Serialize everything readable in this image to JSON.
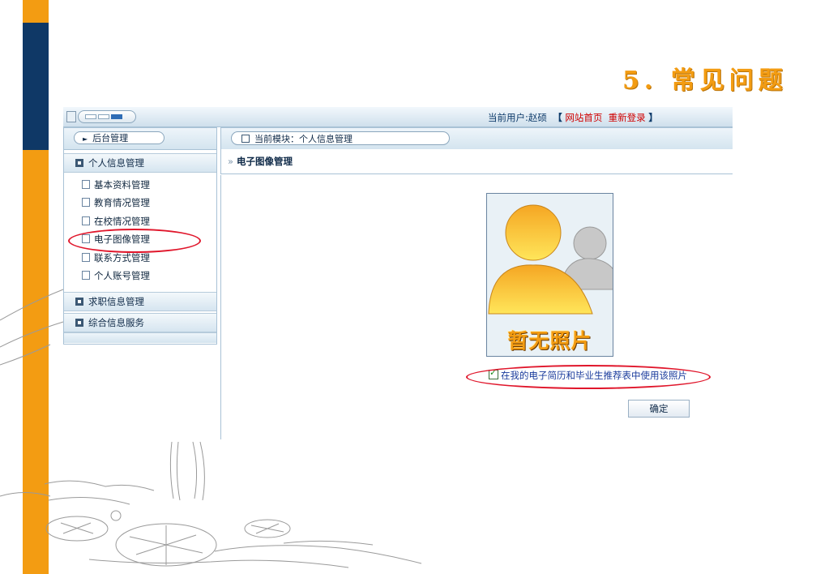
{
  "slide": {
    "title": "5. 常见问题"
  },
  "topbar": {
    "current_user_label": "当前用户:",
    "current_user_name": "赵硕",
    "bracket_open": "【",
    "home_link": "网站首页",
    "relogin_link": "重新登录",
    "bracket_close": "】"
  },
  "sidebar": {
    "header": "后台管理",
    "groups": [
      {
        "label": "个人信息管理",
        "items": [
          "基本资料管理",
          "教育情况管理",
          "在校情况管理",
          "电子图像管理",
          "联系方式管理",
          "个人账号管理"
        ]
      },
      {
        "label": "求职信息管理"
      },
      {
        "label": "综合信息服务"
      }
    ]
  },
  "main": {
    "module_label": "当前模块：个人信息管理",
    "section_title": "电子图像管理",
    "no_photo_text": "暂无照片",
    "use_photo_checkbox": {
      "label": "在我的电子简历和毕业生推荐表中使用该照片",
      "checked": true
    },
    "confirm_button": "确定"
  },
  "colors": {
    "accent_orange": "#f39c12",
    "navy": "#0f3866",
    "highlight_red": "#e0162b",
    "link_red": "#d00000"
  }
}
